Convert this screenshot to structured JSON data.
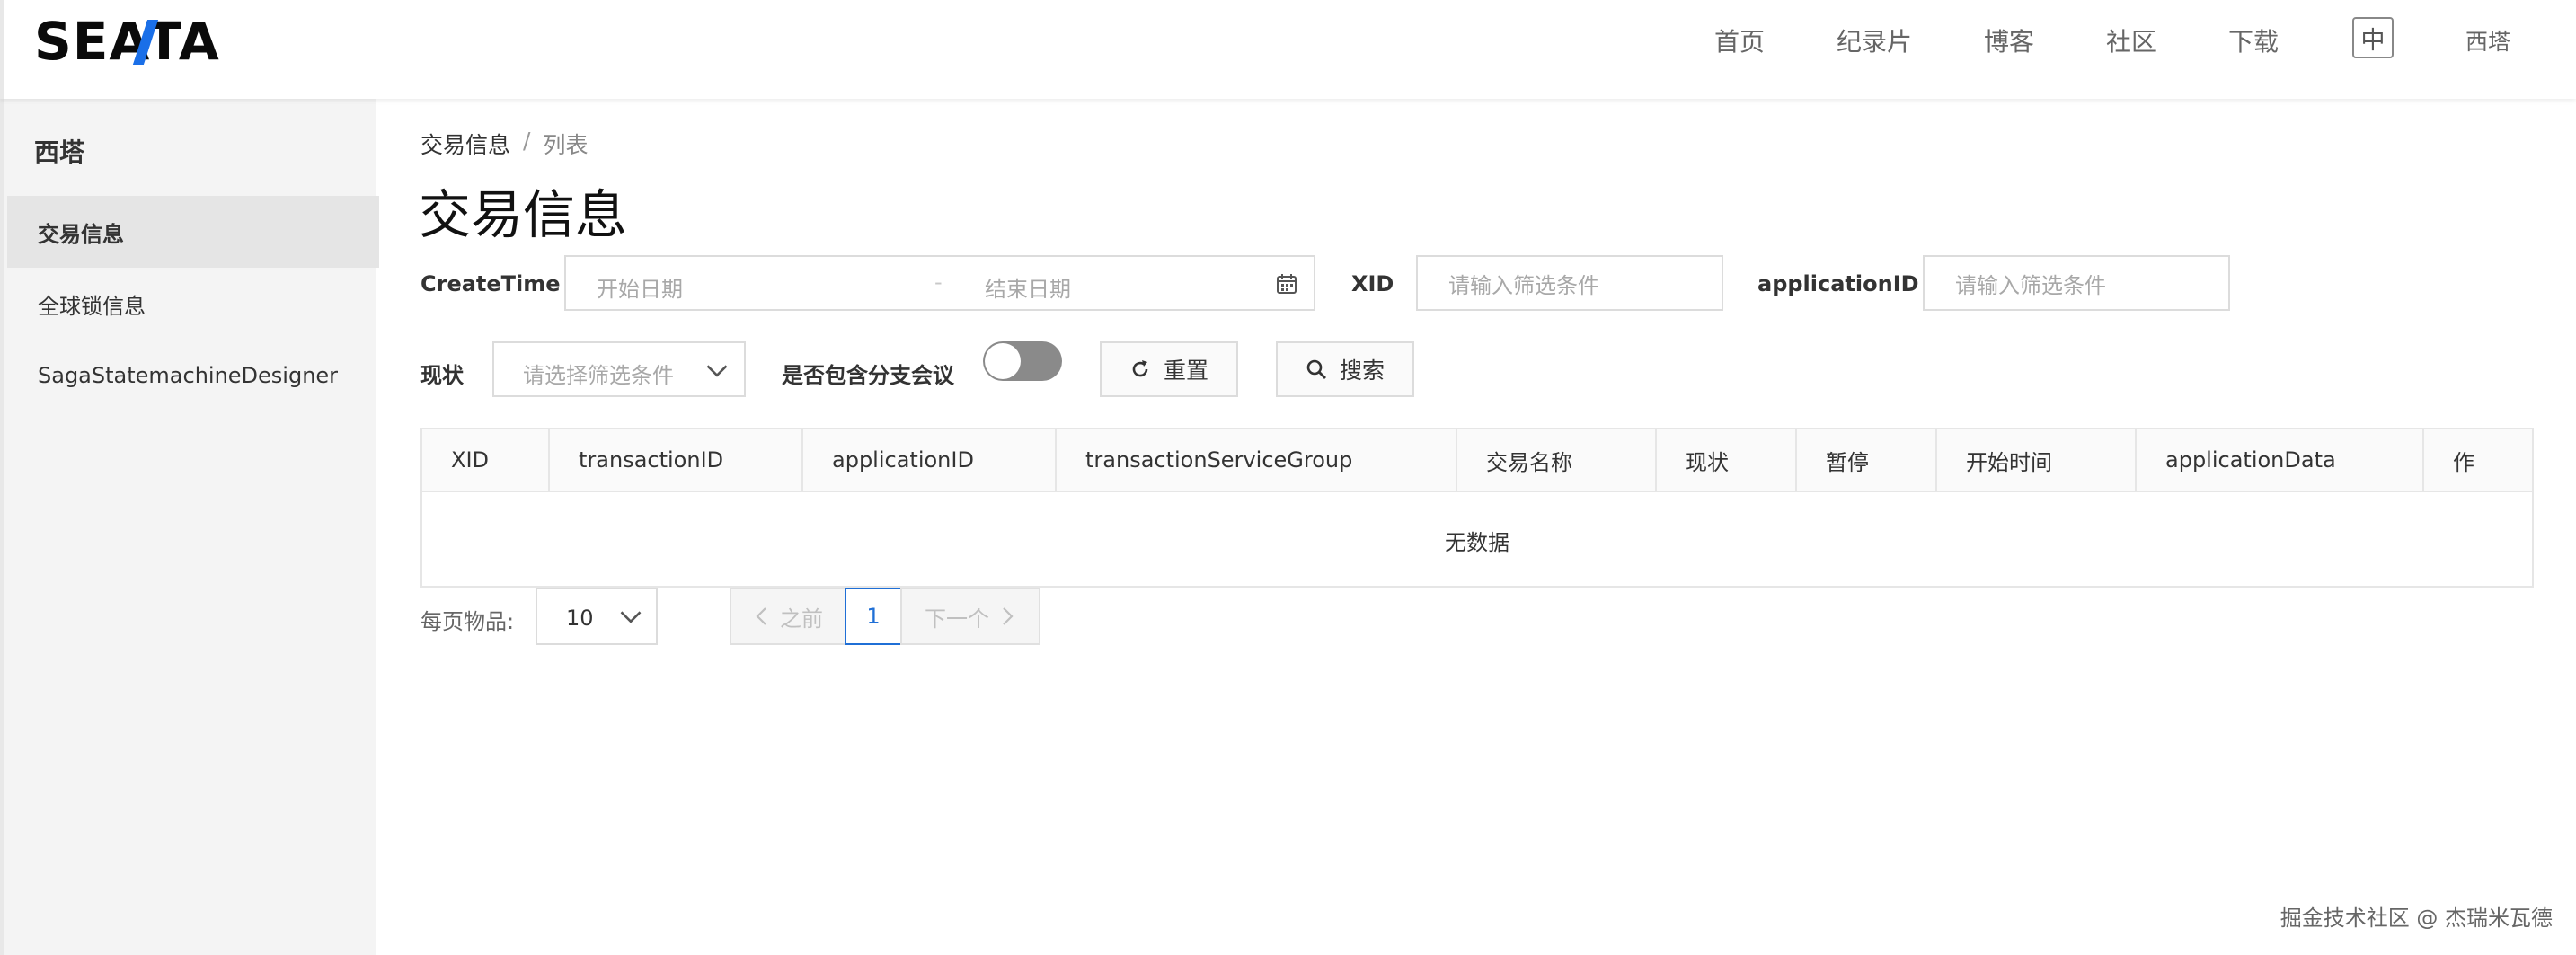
{
  "header": {
    "logo_text": "SEATA",
    "nav": [
      {
        "label": "首页"
      },
      {
        "label": "纪录片"
      },
      {
        "label": "博客"
      },
      {
        "label": "社区"
      },
      {
        "label": "下载"
      }
    ],
    "lang_button": "中",
    "user_label": "西塔"
  },
  "sidebar": {
    "title": "西塔",
    "items": [
      {
        "label": "交易信息",
        "active": true
      },
      {
        "label": "全球锁信息",
        "active": false
      },
      {
        "label": "SagaStatemachineDesigner",
        "active": false
      }
    ]
  },
  "breadcrumb": {
    "first": "交易信息",
    "separator": "/",
    "current": "列表"
  },
  "page_title": "交易信息",
  "filters": {
    "createtime_label": "CreateTime",
    "start_placeholder": "开始日期",
    "range_separator": "-",
    "end_placeholder": "结束日期",
    "xid_label": "XID",
    "xid_placeholder": "请输入筛选条件",
    "appid_label": "applicationID",
    "appid_placeholder": "请输入筛选条件",
    "status_label": "现状",
    "status_placeholder": "请选择筛选条件",
    "include_branch_label": "是否包含分支会议",
    "include_branch_on": false,
    "reset_label": "重置",
    "search_label": "搜索"
  },
  "table": {
    "columns": [
      "XID",
      "transactionID",
      "applicationID",
      "transactionServiceGroup",
      "交易名称",
      "现状",
      "暂停",
      "开始时间",
      "applicationData",
      "作"
    ],
    "empty_text": "无数据"
  },
  "pagination": {
    "page_size_label": "每页物品:",
    "page_size": "10",
    "prev_label": "之前",
    "current_page": "1",
    "next_label": "下一个"
  },
  "watermark": "掘金技术社区 @ 杰瑞米瓦德",
  "colors": {
    "accent": "#1f6fd6",
    "logo_accent": "#1a6fe8",
    "sidebar_bg": "#f4f4f4",
    "toggle_off": "#8a8a8a"
  }
}
